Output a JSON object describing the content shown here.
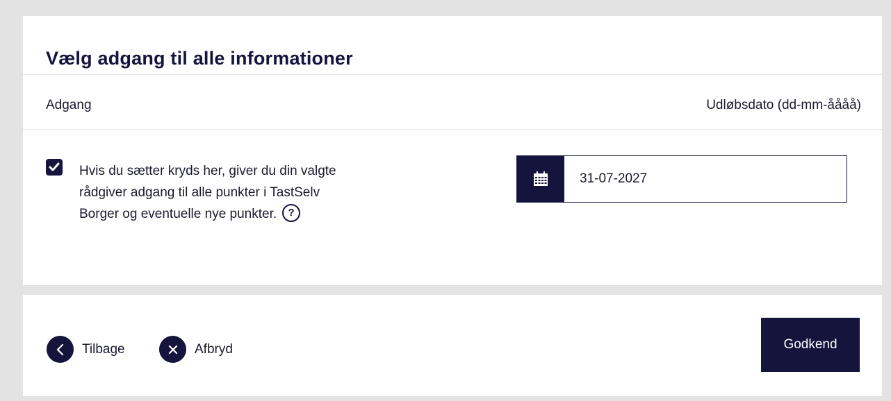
{
  "access_panel": {
    "title": "Vælg adgang til alle informationer",
    "column_access": "Adgang",
    "column_expiry": "Udløbsdato (dd-mm-åååå)",
    "checkbox_checked": true,
    "checkbox_text": "Hvis du sætter kryds her, giver du din valgte rådgiver adgang til alle punkter i TastSelv Borger og eventuelle nye punkter.",
    "help_icon": "question-mark-icon",
    "help_glyph": "?",
    "date_value": "31-07-2027",
    "calendar_icon": "calendar-icon"
  },
  "footer": {
    "back_label": "Tilbage",
    "back_icon": "chevron-left-icon",
    "cancel_label": "Afbryd",
    "cancel_icon": "close-icon",
    "approve_label": "Godkend"
  },
  "colors": {
    "primary": "#14143c",
    "background": "#e3e3e3",
    "card": "#ffffff"
  }
}
